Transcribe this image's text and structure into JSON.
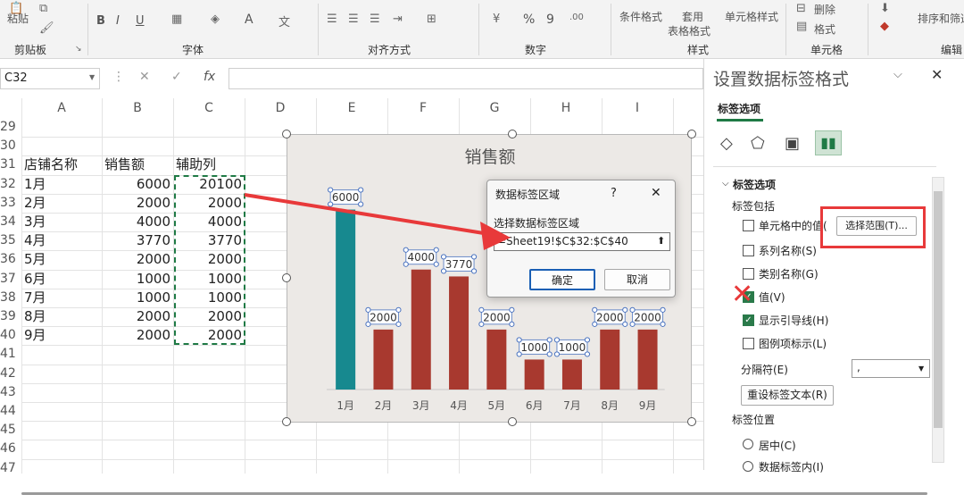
{
  "ribbon": {
    "paste_label": "粘贴",
    "groups": [
      "剪贴板",
      "字体",
      "对齐方式",
      "数字",
      "样式",
      "单元格",
      "编辑"
    ],
    "style_buttons": [
      "条件格式",
      "套用",
      "表格格式",
      "单元格样式"
    ],
    "cell_buttons": [
      "删除",
      "格式"
    ],
    "edit_label": "排序和筛选",
    "font_buttons": [
      "B",
      "I",
      "U",
      "A"
    ],
    "number_symbols": [
      "%",
      "9"
    ]
  },
  "formula_bar": {
    "name_box": "C32",
    "fx": "fx"
  },
  "columns": [
    "A",
    "B",
    "C",
    "D",
    "E",
    "F",
    "G",
    "H",
    "I"
  ],
  "rows": [
    "29",
    "30",
    "31",
    "32",
    "33",
    "34",
    "35",
    "36",
    "37",
    "38",
    "39",
    "40",
    "41",
    "42",
    "43",
    "44",
    "45",
    "46",
    "47"
  ],
  "table": {
    "headers": [
      "店铺名称",
      "销售额",
      "辅助列"
    ],
    "data": [
      [
        "1月",
        "6000",
        "20100"
      ],
      [
        "2月",
        "2000",
        "2000"
      ],
      [
        "3月",
        "4000",
        "4000"
      ],
      [
        "4月",
        "3770",
        "3770"
      ],
      [
        "5月",
        "2000",
        "2000"
      ],
      [
        "6月",
        "1000",
        "1000"
      ],
      [
        "7月",
        "1000",
        "1000"
      ],
      [
        "8月",
        "2000",
        "2000"
      ],
      [
        "9月",
        "2000",
        "2000"
      ]
    ]
  },
  "chart_data": {
    "type": "bar",
    "title": "销售额",
    "categories": [
      "1月",
      "2月",
      "3月",
      "4月",
      "5月",
      "6月",
      "7月",
      "8月",
      "9月"
    ],
    "values": [
      6000,
      2000,
      4000,
      3770,
      2000,
      1000,
      1000,
      2000,
      2000
    ],
    "data_labels": [
      "6000",
      "2000",
      "4000",
      "3770",
      "2000",
      "1000",
      "1000",
      "2000",
      "2000"
    ],
    "ylim": [
      0,
      7000
    ],
    "colors": {
      "highlight": "#17898f",
      "bar": "#a8392f",
      "background": "#ece9e6"
    }
  },
  "dialog": {
    "title": "数据标签区域",
    "help": "?",
    "close": "✕",
    "prompt": "选择数据标签区域",
    "range_value": "=Sheet19!$C$32:$C$40",
    "ok": "确定",
    "cancel": "取消"
  },
  "pane": {
    "title": "设置数据标签格式",
    "tab": "标签选项",
    "section": "标签选项",
    "includes_label": "标签包括",
    "options": [
      {
        "label": "单元格中的值(",
        "checked": false
      },
      {
        "label": "系列名称(S)",
        "checked": false
      },
      {
        "label": "类别名称(G)",
        "checked": false
      },
      {
        "label": "值(V)",
        "checked": true
      },
      {
        "label": "显示引导线(H)",
        "checked": true
      },
      {
        "label": "图例项标示(L)",
        "checked": false
      }
    ],
    "select_range_button": "选择范围(T)...",
    "separator_label": "分隔符(E)",
    "separator_value": ",",
    "reset_button": "重设标签文本(R)",
    "position_label": "标签位置",
    "positions": [
      "居中(C)",
      "数据标签内(I)"
    ]
  },
  "accent_colors": {
    "annotation_red": "#e8393a",
    "excel_green": "#1f7a45"
  }
}
